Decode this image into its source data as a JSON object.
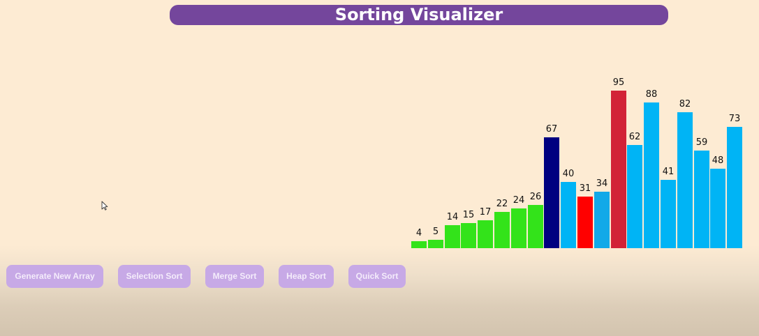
{
  "header": {
    "title": "Sorting Visualizer",
    "color": "#74469c"
  },
  "array": {
    "values": [
      4,
      5,
      14,
      15,
      17,
      22,
      24,
      26,
      67,
      40,
      31,
      34,
      95,
      62,
      88,
      41,
      82,
      59,
      48,
      73
    ],
    "states": [
      "sorted",
      "sorted",
      "sorted",
      "sorted",
      "sorted",
      "sorted",
      "sorted",
      "sorted",
      "current",
      "unsorted",
      "min",
      "comparing",
      "swap",
      "unsorted",
      "unsorted",
      "unsorted",
      "unsorted",
      "unsorted",
      "unsorted",
      "unsorted"
    ]
  },
  "colors": {
    "sorted": "#33e31a",
    "current": "#000080",
    "unsorted": "#00b4f5",
    "min": "#ff0000",
    "comparing": "#12a9e8",
    "swap": "#d22337",
    "button_bg": "#c7a9e6"
  },
  "controls": {
    "generate_label": "Generate New Array",
    "selection_label": "Selection Sort",
    "merge_label": "Merge Sort",
    "heap_label": "Heap Sort",
    "quick_label": "Quick Sort"
  },
  "cursor_icon": "mouse-pointer-icon"
}
